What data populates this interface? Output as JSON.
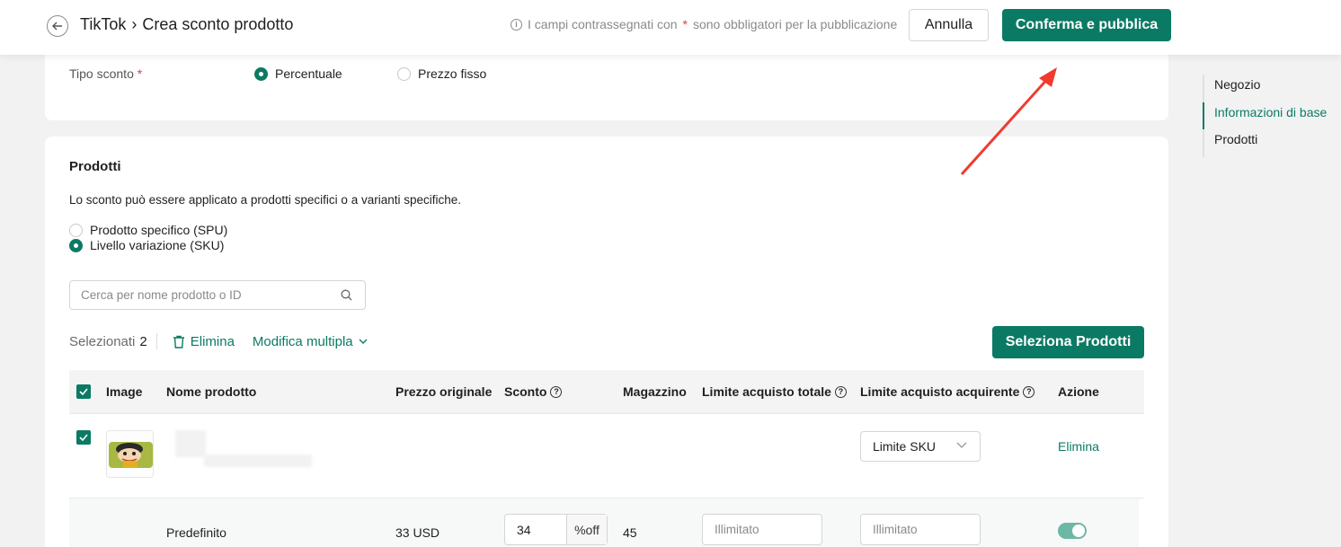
{
  "header": {
    "breadcrumb_root": "TikTok",
    "breadcrumb_sep": "›",
    "page_title": "Crea sconto prodotto",
    "required_note_before": "I campi contrassegnati con",
    "required_star": "*",
    "required_note_after": "sono obbligatori per la pubblicazione",
    "cancel_label": "Annulla",
    "confirm_label": "Conferma e pubblica"
  },
  "discount_type": {
    "label": "Tipo sconto",
    "star": "*",
    "options": [
      {
        "label": "Percentuale",
        "selected": true
      },
      {
        "label": "Prezzo fisso",
        "selected": false
      }
    ]
  },
  "products": {
    "title": "Prodotti",
    "description": "Lo sconto può essere applicato a prodotti specifici o a varianti specifiche.",
    "scope_options": [
      {
        "label": "Prodotto specifico (SPU)",
        "selected": false
      },
      {
        "label": "Livello variazione (SKU)",
        "selected": true
      }
    ],
    "search_placeholder": "Cerca per nome prodotto o ID",
    "selected_label": "Selezionati",
    "selected_count": "2",
    "delete_label": "Elimina",
    "bulk_edit_label": "Modifica multipla",
    "select_products_label": "Seleziona Prodotti",
    "columns": {
      "image": "Image",
      "name": "Nome prodotto",
      "orig_price": "Prezzo originale",
      "discount": "Sconto",
      "stock": "Magazzino",
      "total_limit": "Limite acquisto totale",
      "buyer_limit": "Limite acquisto acquirente",
      "action": "Azione"
    },
    "product_row": {
      "limit_select": "Limite SKU",
      "action": "Elimina"
    },
    "variant_row": {
      "name": "Predefinito",
      "price": "33 USD",
      "discount_value": "34",
      "discount_unit": "%off",
      "stock": "45",
      "total_limit_placeholder": "Illimitato",
      "buyer_limit_placeholder": "Illimitato",
      "enabled": true
    }
  },
  "side_nav": {
    "items": [
      {
        "label": "Negozio",
        "active": false
      },
      {
        "label": "Informazioni di base",
        "active": true
      },
      {
        "label": "Prodotti",
        "active": false
      }
    ]
  },
  "colors": {
    "brand": "#0b7a64",
    "required": "#e63946",
    "annotation_arrow": "#f23a2f"
  },
  "icons": [
    "back-arrow-icon",
    "info-icon",
    "search-icon",
    "trash-icon",
    "chevron-down-icon",
    "help-icon",
    "check-icon"
  ]
}
